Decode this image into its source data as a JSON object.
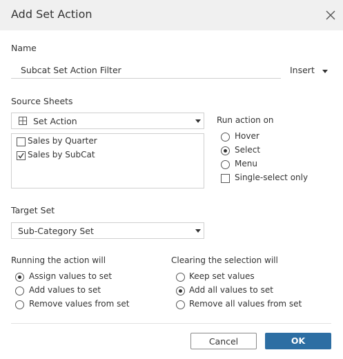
{
  "dialog": {
    "title": "Add Set Action"
  },
  "name_section": {
    "label": "Name",
    "value": "Subcat Set Action Filter",
    "insert_label": "Insert"
  },
  "source_sheets": {
    "label": "Source Sheets",
    "selected_source": "Set Action",
    "sheets": [
      {
        "label": "Sales by Quarter",
        "checked": false
      },
      {
        "label": "Sales by SubCat",
        "checked": true
      }
    ]
  },
  "run_action_on": {
    "label": "Run action on",
    "options": [
      {
        "label": "Hover",
        "selected": false
      },
      {
        "label": "Select",
        "selected": true
      },
      {
        "label": "Menu",
        "selected": false
      }
    ],
    "single_select": {
      "label": "Single-select only",
      "checked": false
    }
  },
  "target_set": {
    "label": "Target Set",
    "value": "Sub-Category Set"
  },
  "running_action": {
    "label": "Running the action will",
    "options": [
      {
        "label": "Assign values to set",
        "selected": true
      },
      {
        "label": "Add values to set",
        "selected": false
      },
      {
        "label": "Remove values from set",
        "selected": false
      }
    ]
  },
  "clearing_selection": {
    "label": "Clearing the selection will",
    "options": [
      {
        "label": "Keep set values",
        "selected": false
      },
      {
        "label": "Add all values to set",
        "selected": true
      },
      {
        "label": "Remove all values from set",
        "selected": false
      }
    ]
  },
  "buttons": {
    "cancel": "Cancel",
    "ok": "OK"
  },
  "colors": {
    "primary": "#2d6ea3",
    "titlebar": "#f0f0f0",
    "border": "#cfcfcf"
  }
}
